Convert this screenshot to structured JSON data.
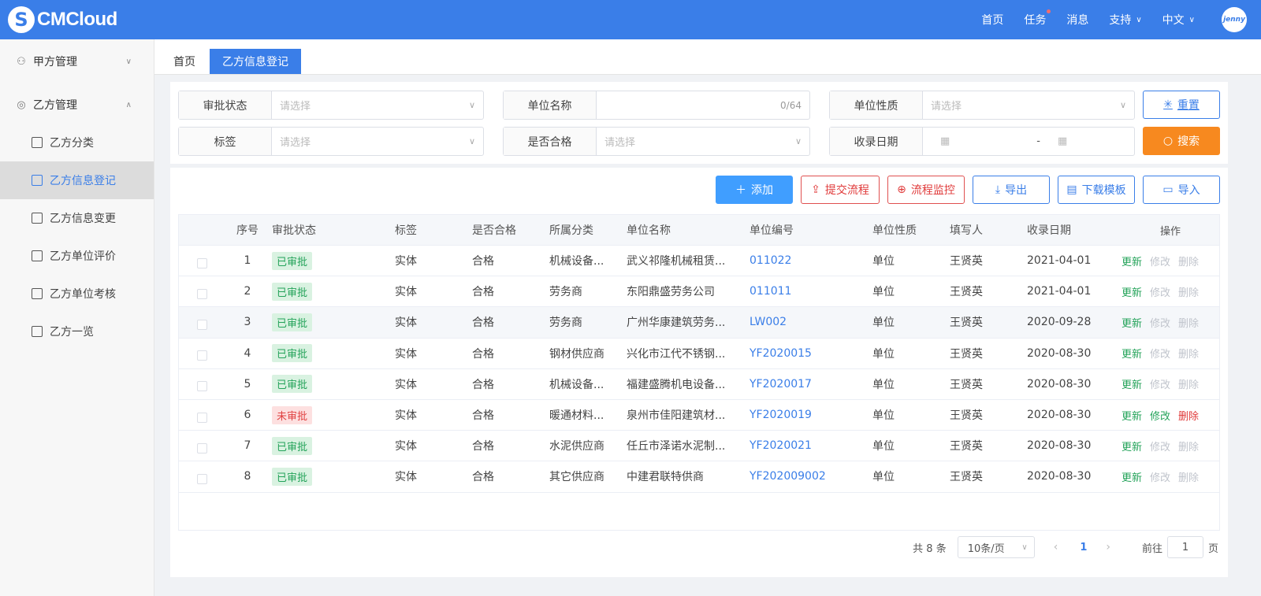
{
  "app": {
    "logo_text": "CMCloud",
    "logo_mark": "S"
  },
  "topnav": {
    "home": "首页",
    "tasks": "任务",
    "messages": "消息",
    "support": "支持",
    "language": "中文",
    "avatar_text": "jenny"
  },
  "sidebar": {
    "group_a": "甲方管理",
    "group_b": "乙方管理",
    "items": [
      "乙方分类",
      "乙方信息登记",
      "乙方信息变更",
      "乙方单位评价",
      "乙方单位考核",
      "乙方一览"
    ]
  },
  "tabs": [
    "首页",
    "乙方信息登记"
  ],
  "filters": {
    "approval_label": "审批状态",
    "approval_placeholder": "请选择",
    "unit_name_label": "单位名称",
    "unit_name_count": "0/64",
    "unit_nature_label": "单位性质",
    "unit_nature_placeholder": "请选择",
    "tag_label": "标签",
    "tag_placeholder": "请选择",
    "qualified_label": "是否合格",
    "qualified_placeholder": "请选择",
    "date_label": "收录日期",
    "date_sep": "-",
    "reset": "重置",
    "search": "搜索"
  },
  "actions": {
    "add": "添加",
    "submit_flow": "提交流程",
    "monitor_flow": "流程监控",
    "export": "导出",
    "download_template": "下载模板",
    "import": "导入"
  },
  "table": {
    "headers": [
      "序号",
      "审批状态",
      "标签",
      "是否合格",
      "所属分类",
      "单位名称",
      "单位编号",
      "单位性质",
      "填写人",
      "收录日期",
      "操作"
    ],
    "rows": [
      {
        "no": "1",
        "status": "已审批",
        "tag": "实体",
        "ok": "合格",
        "cat": "机械设备...",
        "name": "武义祁隆机械租赁...",
        "code": "011022",
        "nature": "单位",
        "who": "王贤英",
        "date": "2021-04-01"
      },
      {
        "no": "2",
        "status": "已审批",
        "tag": "实体",
        "ok": "合格",
        "cat": "劳务商",
        "name": "东阳鼎盛劳务公司",
        "code": "011011",
        "nature": "单位",
        "who": "王贤英",
        "date": "2021-04-01"
      },
      {
        "no": "3",
        "status": "已审批",
        "tag": "实体",
        "ok": "合格",
        "cat": "劳务商",
        "name": "广州华康建筑劳务...",
        "code": "LW002",
        "nature": "单位",
        "who": "王贤英",
        "date": "2020-09-28"
      },
      {
        "no": "4",
        "status": "已审批",
        "tag": "实体",
        "ok": "合格",
        "cat": "钢材供应商",
        "name": "兴化市江代不锈钢...",
        "code": "YF2020015",
        "nature": "单位",
        "who": "王贤英",
        "date": "2020-08-30"
      },
      {
        "no": "5",
        "status": "已审批",
        "tag": "实体",
        "ok": "合格",
        "cat": "机械设备...",
        "name": "福建盛腾机电设备...",
        "code": "YF2020017",
        "nature": "单位",
        "who": "王贤英",
        "date": "2020-08-30"
      },
      {
        "no": "6",
        "status": "未审批",
        "tag": "实体",
        "ok": "合格",
        "cat": "暖通材料...",
        "name": "泉州市佳阳建筑材...",
        "code": "YF2020019",
        "nature": "单位",
        "who": "王贤英",
        "date": "2020-08-30"
      },
      {
        "no": "7",
        "status": "已审批",
        "tag": "实体",
        "ok": "合格",
        "cat": "水泥供应商",
        "name": "任丘市泽诺水泥制...",
        "code": "YF2020021",
        "nature": "单位",
        "who": "王贤英",
        "date": "2020-08-30"
      },
      {
        "no": "8",
        "status": "已审批",
        "tag": "实体",
        "ok": "合格",
        "cat": "其它供应商",
        "name": "中建君联特供商",
        "code": "YF202009002",
        "nature": "单位",
        "who": "王贤英",
        "date": "2020-08-30"
      }
    ],
    "ops": {
      "update": "更新",
      "edit": "修改",
      "delete": "删除"
    }
  },
  "pager": {
    "total": "共 8 条",
    "page_size": "10条/页",
    "current": "1",
    "goto_prefix": "前往",
    "goto_value": "1",
    "goto_suffix": "页"
  },
  "colors": {
    "brand": "#3a7ee8",
    "search_button": "#f7891f",
    "approved": "#24a35a",
    "pending": "#e04040"
  }
}
